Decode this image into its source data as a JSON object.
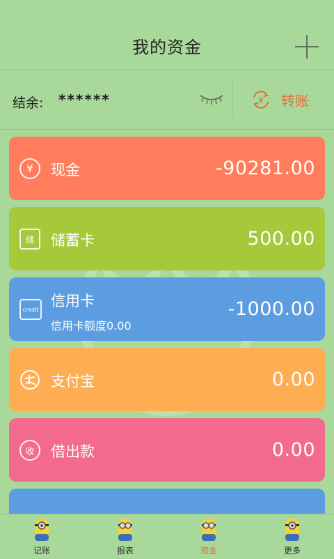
{
  "header": {
    "title": "我的资金"
  },
  "balance": {
    "label": "结余:",
    "value": "******",
    "transfer_label": "转账"
  },
  "accounts": [
    {
      "name": "现金",
      "amount": "-90281.00",
      "color": "#ff7d5c",
      "icon": "yuan-icon",
      "glyph": "¥"
    },
    {
      "name": "储蓄卡",
      "amount": "500.00",
      "color": "#a6c83b",
      "icon": "savings-card-icon",
      "glyph": "储"
    },
    {
      "name": "信用卡",
      "sub": "信用卡额度0.00",
      "amount": "-1000.00",
      "color": "#5b9de0",
      "icon": "credit-card-icon",
      "glyph": "credit"
    },
    {
      "name": "支付宝",
      "amount": "0.00",
      "color": "#ffad52",
      "icon": "alipay-icon",
      "glyph": ""
    },
    {
      "name": "借出款",
      "amount": "0.00",
      "color": "#f26a8d",
      "icon": "loan-out-icon",
      "glyph": "收"
    },
    {
      "name": "",
      "amount": "",
      "color": "#5b9de0",
      "icon": "",
      "glyph": ""
    }
  ],
  "tabs": [
    {
      "label": "记账",
      "active": false
    },
    {
      "label": "报表",
      "active": false
    },
    {
      "label": "资金",
      "active": true
    },
    {
      "label": "更多",
      "active": false
    }
  ],
  "colors": {
    "accent": "#e06f3c",
    "background": "#a9d99a"
  }
}
